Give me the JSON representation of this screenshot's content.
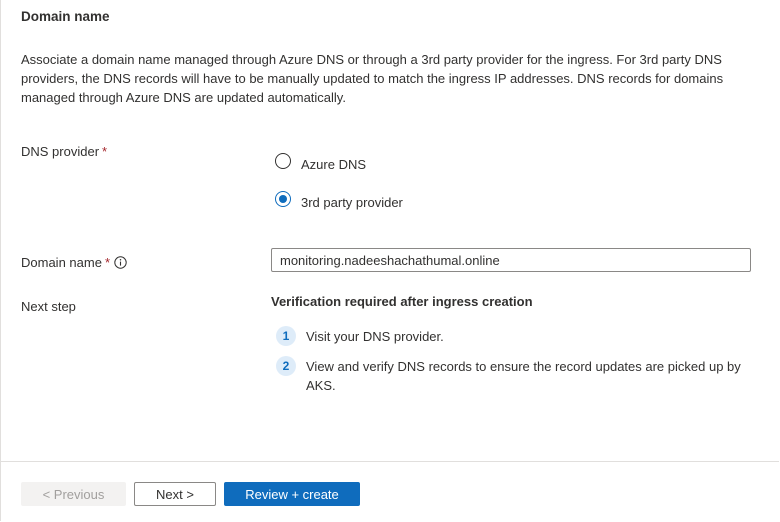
{
  "section": {
    "title": "Domain name",
    "description": "Associate a domain name managed through Azure DNS or through a 3rd party provider for the ingress. For 3rd party DNS providers, the DNS records will have to be manually updated to match the ingress IP addresses. DNS records for domains managed through Azure DNS are updated automatically."
  },
  "dns_provider": {
    "label": "DNS provider",
    "required_mark": "*",
    "options": [
      {
        "label": "Azure DNS",
        "selected": false
      },
      {
        "label": "3rd party provider",
        "selected": true
      }
    ]
  },
  "domain_name": {
    "label": "Domain name",
    "required_mark": "*",
    "value": "monitoring.nadeeshachathumal.online"
  },
  "next_step": {
    "label": "Next step",
    "title": "Verification required after ingress creation",
    "steps": [
      {
        "number": "1",
        "text": "Visit your DNS provider."
      },
      {
        "number": "2",
        "text": "View and verify DNS records to ensure the record updates are picked up by AKS."
      }
    ]
  },
  "footer": {
    "previous_label": "< Previous",
    "next_label": "Next >",
    "review_label": "Review + create"
  },
  "colors": {
    "accent": "#0f6cbd",
    "required": "#a4262c",
    "step_badge_bg": "#deecf9"
  }
}
